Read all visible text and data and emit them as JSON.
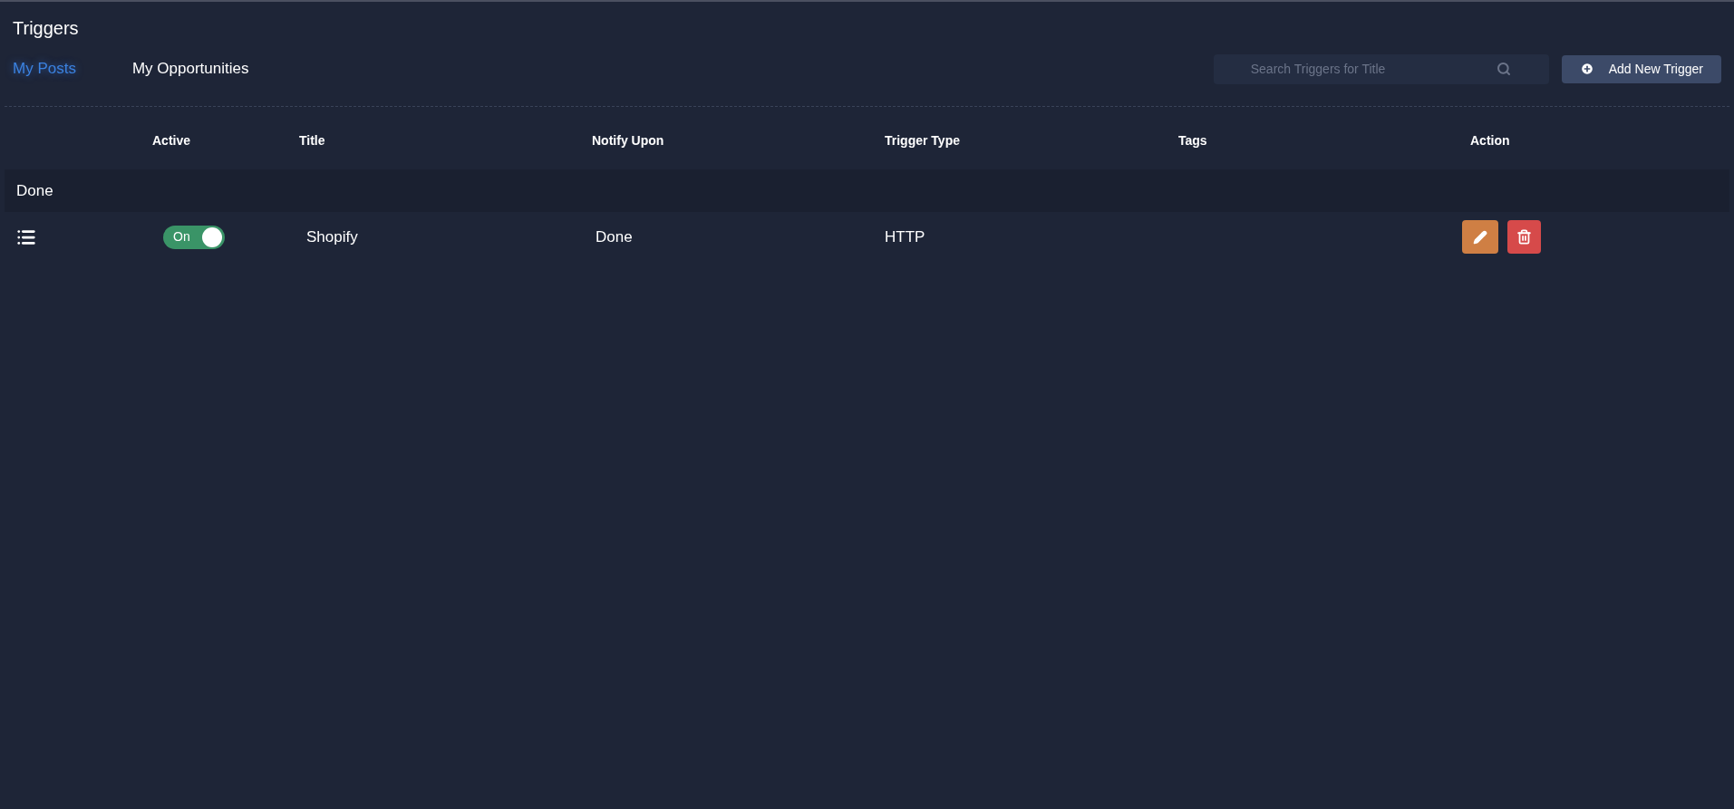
{
  "page_title": "Triggers",
  "tabs": [
    {
      "label": "My Posts",
      "selected": true
    },
    {
      "label": "My Opportunities",
      "selected": false
    }
  ],
  "search": {
    "placeholder": "Search Triggers for Title"
  },
  "add_button": "Add New Trigger",
  "table": {
    "columns": [
      "Active",
      "Title",
      "Notify Upon",
      "Trigger Type",
      "Tags",
      "Action"
    ],
    "groups": [
      {
        "label": "Done",
        "rows": [
          {
            "active": {
              "label": "On",
              "on": true
            },
            "title": "Shopify",
            "notify_upon": "Done",
            "trigger_type": "HTTP"
          }
        ]
      }
    ]
  }
}
